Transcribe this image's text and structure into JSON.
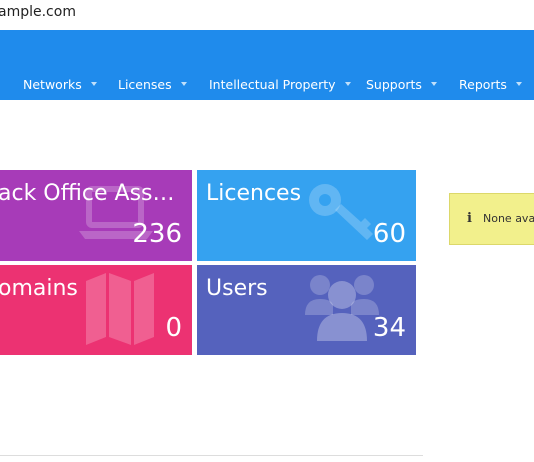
{
  "browser": {
    "url_fragment": "ample.com"
  },
  "nav": {
    "items": [
      {
        "label": "Networks"
      },
      {
        "label": "Licenses"
      },
      {
        "label": "Intellectual Property"
      },
      {
        "label": "Supports"
      },
      {
        "label": "Reports"
      }
    ]
  },
  "tiles": {
    "back_office": {
      "title": "ack Office Ass…",
      "count": "236",
      "color": "#a73bb8",
      "icon": "laptop-icon"
    },
    "licences": {
      "title": "Licences",
      "count": "60",
      "color": "#35a2f0",
      "icon": "key-icon"
    },
    "domains": {
      "title": "omains",
      "count": "0",
      "color": "#ec3272",
      "icon": "map-icon"
    },
    "users": {
      "title": "Users",
      "count": "34",
      "color": "#5562bd",
      "icon": "users-icon"
    }
  },
  "alert": {
    "icon": "info-icon",
    "text": "None ava"
  }
}
